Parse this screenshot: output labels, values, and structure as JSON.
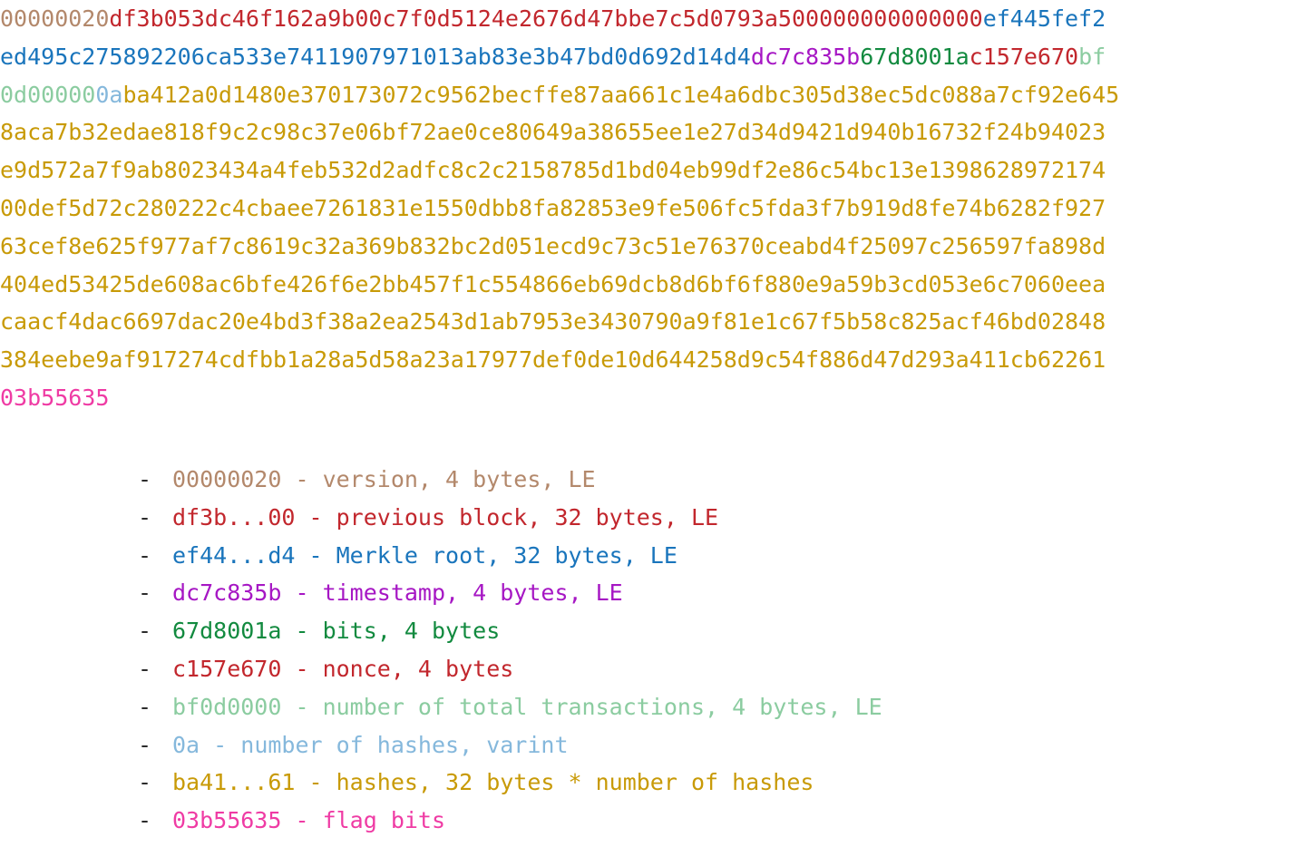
{
  "palette": {
    "version_brown": "#b3886b",
    "prev_block_red": "#c2272d",
    "merkle_blue": "#1a75bc",
    "timestamp_purple": "#a617c4",
    "bits_green": "#128a3f",
    "nonce_red": "#c2272d",
    "total_tx_lightgreen": "#8bcca0",
    "num_hashes_lightblue": "#85b8dc",
    "hashes_gold": "#c89a07",
    "flag_bits_magenta": "#ef3ba4",
    "dash_dark": "#2b2b2b",
    "background": "#ffffff"
  },
  "hexdump": {
    "lines": [
      [
        {
          "text": "00000020",
          "color_key": "version_brown"
        },
        {
          "text": "df3b053dc46f162a9b00c7f0d5124e2676d47bbe7c5d0793a500000000000000",
          "color_key": "prev_block_red"
        },
        {
          "text": "ef445fef2",
          "color_key": "merkle_blue"
        }
      ],
      [
        {
          "text": "ed495c275892206ca533e7411907971013ab83e3b47bd0d692d14d4",
          "color_key": "merkle_blue"
        },
        {
          "text": "dc7c835b",
          "color_key": "timestamp_purple"
        },
        {
          "text": "67d8001a",
          "color_key": "bits_green"
        },
        {
          "text": "c157e670",
          "color_key": "nonce_red"
        },
        {
          "text": "bf",
          "color_key": "total_tx_lightgreen"
        }
      ],
      [
        {
          "text": "0d00000",
          "color_key": "total_tx_lightgreen"
        },
        {
          "text": "0a",
          "color_key": "num_hashes_lightblue"
        },
        {
          "text": "ba412a0d1480e370173072c9562becffe87aa661c1e4a6dbc305d38ec5dc088a7cf92e645",
          "color_key": "hashes_gold"
        }
      ],
      [
        {
          "text": "8aca7b32edae818f9c2c98c37e06bf72ae0ce80649a38655ee1e27d34d9421d940b16732f24b94023",
          "color_key": "hashes_gold"
        }
      ],
      [
        {
          "text": "e9d572a7f9ab8023434a4feb532d2adfc8c2c2158785d1bd04eb99df2e86c54bc13e1398628972174",
          "color_key": "hashes_gold"
        }
      ],
      [
        {
          "text": "00def5d72c280222c4cbaee7261831e1550dbb8fa82853e9fe506fc5fda3f7b919d8fe74b6282f927",
          "color_key": "hashes_gold"
        }
      ],
      [
        {
          "text": "63cef8e625f977af7c8619c32a369b832bc2d051ecd9c73c51e76370ceabd4f25097c256597fa898d",
          "color_key": "hashes_gold"
        }
      ],
      [
        {
          "text": "404ed53425de608ac6bfe426f6e2bb457f1c554866eb69dcb8d6bf6f880e9a59b3cd053e6c7060eea",
          "color_key": "hashes_gold"
        }
      ],
      [
        {
          "text": "caacf4dac6697dac20e4bd3f38a2ea2543d1ab7953e3430790a9f81e1c67f5b58c825acf46bd02848",
          "color_key": "hashes_gold"
        }
      ],
      [
        {
          "text": "384eebe9af917274cdfbb1a28a5d58a23a17977def0de10d644258d9c54f886d47d293a411cb62261",
          "color_key": "hashes_gold"
        }
      ],
      [
        {
          "text": "03b55635",
          "color_key": "flag_bits_magenta"
        }
      ]
    ]
  },
  "legend": {
    "bullet": "-",
    "items": [
      {
        "hex": "00000020",
        "description": "version, 4 bytes, LE",
        "color_key": "version_brown"
      },
      {
        "hex": "df3b...00",
        "description": "previous block, 32 bytes, LE",
        "color_key": "prev_block_red"
      },
      {
        "hex": "ef44...d4",
        "description": "Merkle root, 32 bytes, LE",
        "color_key": "merkle_blue"
      },
      {
        "hex": "dc7c835b",
        "description": "timestamp, 4 bytes, LE",
        "color_key": "timestamp_purple"
      },
      {
        "hex": "67d8001a",
        "description": "bits, 4 bytes",
        "color_key": "bits_green"
      },
      {
        "hex": "c157e670",
        "description": "nonce, 4 bytes",
        "color_key": "nonce_red"
      },
      {
        "hex": "bf0d0000",
        "description": "number of total transactions, 4 bytes, LE",
        "color_key": "total_tx_lightgreen"
      },
      {
        "hex": "0a",
        "description": "number of hashes, varint",
        "color_key": "num_hashes_lightblue"
      },
      {
        "hex": "ba41...61",
        "description": "hashes, 32 bytes * number of hashes",
        "color_key": "hashes_gold"
      },
      {
        "hex": "03b55635",
        "description": "flag bits",
        "color_key": "flag_bits_magenta"
      }
    ]
  }
}
